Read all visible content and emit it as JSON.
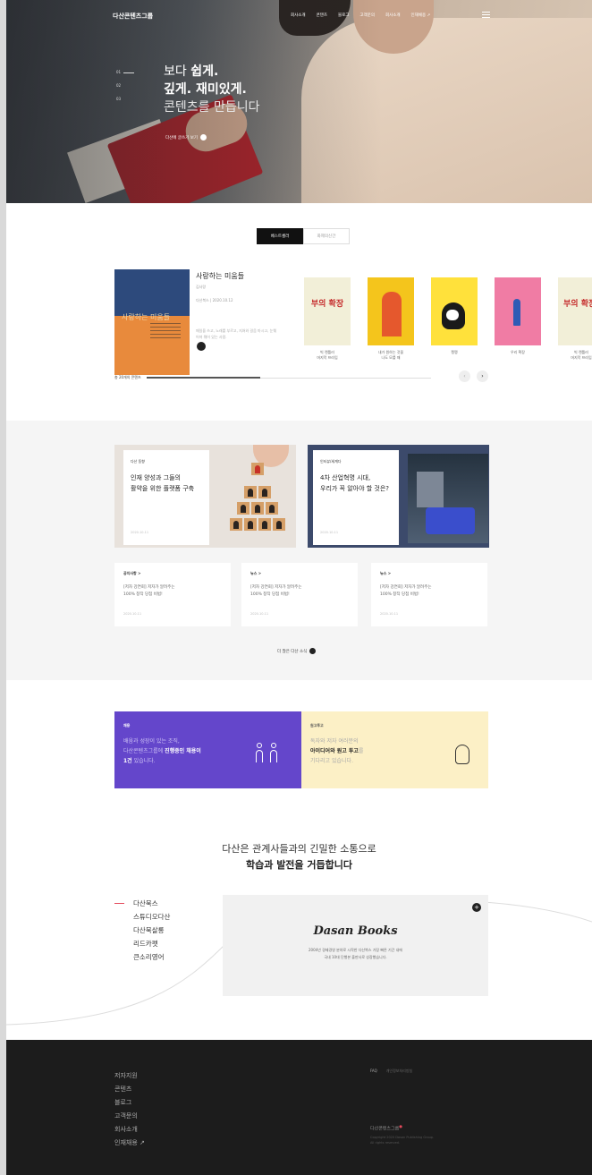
{
  "header": {
    "logo": "다산콘텐츠그룹",
    "nav": [
      "회사소개",
      "콘텐츠",
      "블로그",
      "고객문의",
      "회사소개",
      "인재채용 ↗"
    ]
  },
  "hero": {
    "indicators": [
      "01",
      "02",
      "03"
    ],
    "title_line1_a": "보다 ",
    "title_line1_b": "쉽게.",
    "title_line2": "깊게. 재미있게.",
    "title_line3": "콘텐츠를 만듭니다",
    "cta": "다산에 글쓰기 보기"
  },
  "books": {
    "tabs": [
      "베스트셀러",
      "화제의신간"
    ],
    "featured": {
      "cover_title": "사랑하는 미움들",
      "title": "사랑하는 미움들",
      "author": "김사랑",
      "meta": "다산북스 | 2020.10.12",
      "desc": "매일을 쓰고, 노래를 부르고, 지쳐와 걸음 마시고, 눈웨어져 웨어 있는 사람."
    },
    "carousel": [
      {
        "cover_text": "부의 확장",
        "caption": "빅 렌틀러\n머지막 프라임"
      },
      {
        "cover_text": "",
        "caption": "내가 원하는 것을\n나도 모를 때"
      },
      {
        "cover_text": "",
        "caption": "펭펭"
      },
      {
        "cover_text": "",
        "caption": "우리 확장"
      },
      {
        "cover_text": "부의 확장",
        "caption": "빅 렌틀러\n머지막 프라임"
      }
    ],
    "progress_label": "총 20개의 콘텐츠"
  },
  "features": [
    {
      "category": "다산 동향",
      "title": "인재 양성과 그들의\n활약을 위한 플랫폼 구축",
      "date": "2020.10.11"
    },
    {
      "category": "인터뷰/세계다",
      "title": "4차 산업혁명 시대,\n우리가 꼭 알아야 할 것은?",
      "date": "2020.10.11"
    }
  ],
  "news": [
    {
      "category": "공지사항 >",
      "text": "[저자 강연회] 저자가 알려주는\n100% 창작 당첨 비법!",
      "date": "2020.10.11"
    },
    {
      "category": "뉴스 >",
      "text": "[저자 강연회] 저자가 알려주는\n100% 창작 당첨 비법!",
      "date": "2020.10.11"
    },
    {
      "category": "뉴스 >",
      "text": "[저자 강연회] 저자가 알려주는\n100% 창작 당첨 비법!",
      "date": "2020.10.11"
    }
  ],
  "more_label": "더 많은 다산 소식",
  "banners": {
    "hire": {
      "tag": "채용",
      "line1": "배움과 성장이 있는 조직,",
      "line2_a": "다산콘텐츠그룹에 ",
      "line2_b": "진행중인 채용이",
      "line3_a": "1건",
      "line3_b": " 있습니다."
    },
    "submit": {
      "tag": "원고투고",
      "line1": "독자와 저자 여러분의",
      "line2_a": "아이디어와 원고 투고",
      "line2_b": "를",
      "line3": "기다리고 있습니다."
    }
  },
  "slogan": {
    "line1": "다산은 관계사들과의 긴밀한 소통으로",
    "line2": "학습과 발전을 거듭합니다"
  },
  "brands": [
    "다산북스",
    "스튜디오다산",
    "다산북살롱",
    "리드카펫",
    "큰소리영어"
  ],
  "brand_box": {
    "logo": "Dasan Books",
    "desc_line1": "2004년 경제경영 분야로 시작한 다산북스 가장 빠른 기간 내에",
    "desc_line2": "국내 10대 단행본 출판사로 성장했습니다."
  },
  "footer": {
    "links": [
      "저자지원",
      "콘텐츠",
      "블로그",
      "고객문의",
      "회사소개",
      "인재채용 ↗"
    ],
    "right_links": [
      "FAQ",
      "개인정보처리방침"
    ],
    "brand": "다산콘텐츠그룹",
    "copyright_line1": "Copyright 2020 Dasan Publishing Group.",
    "copyright_line2": "All rights reserved."
  },
  "colors": {
    "accent_purple": "#6446cb",
    "accent_yellow": "#fcf0c6",
    "footer_bg": "#1c1c1c",
    "accent_red": "#e44a5c"
  }
}
